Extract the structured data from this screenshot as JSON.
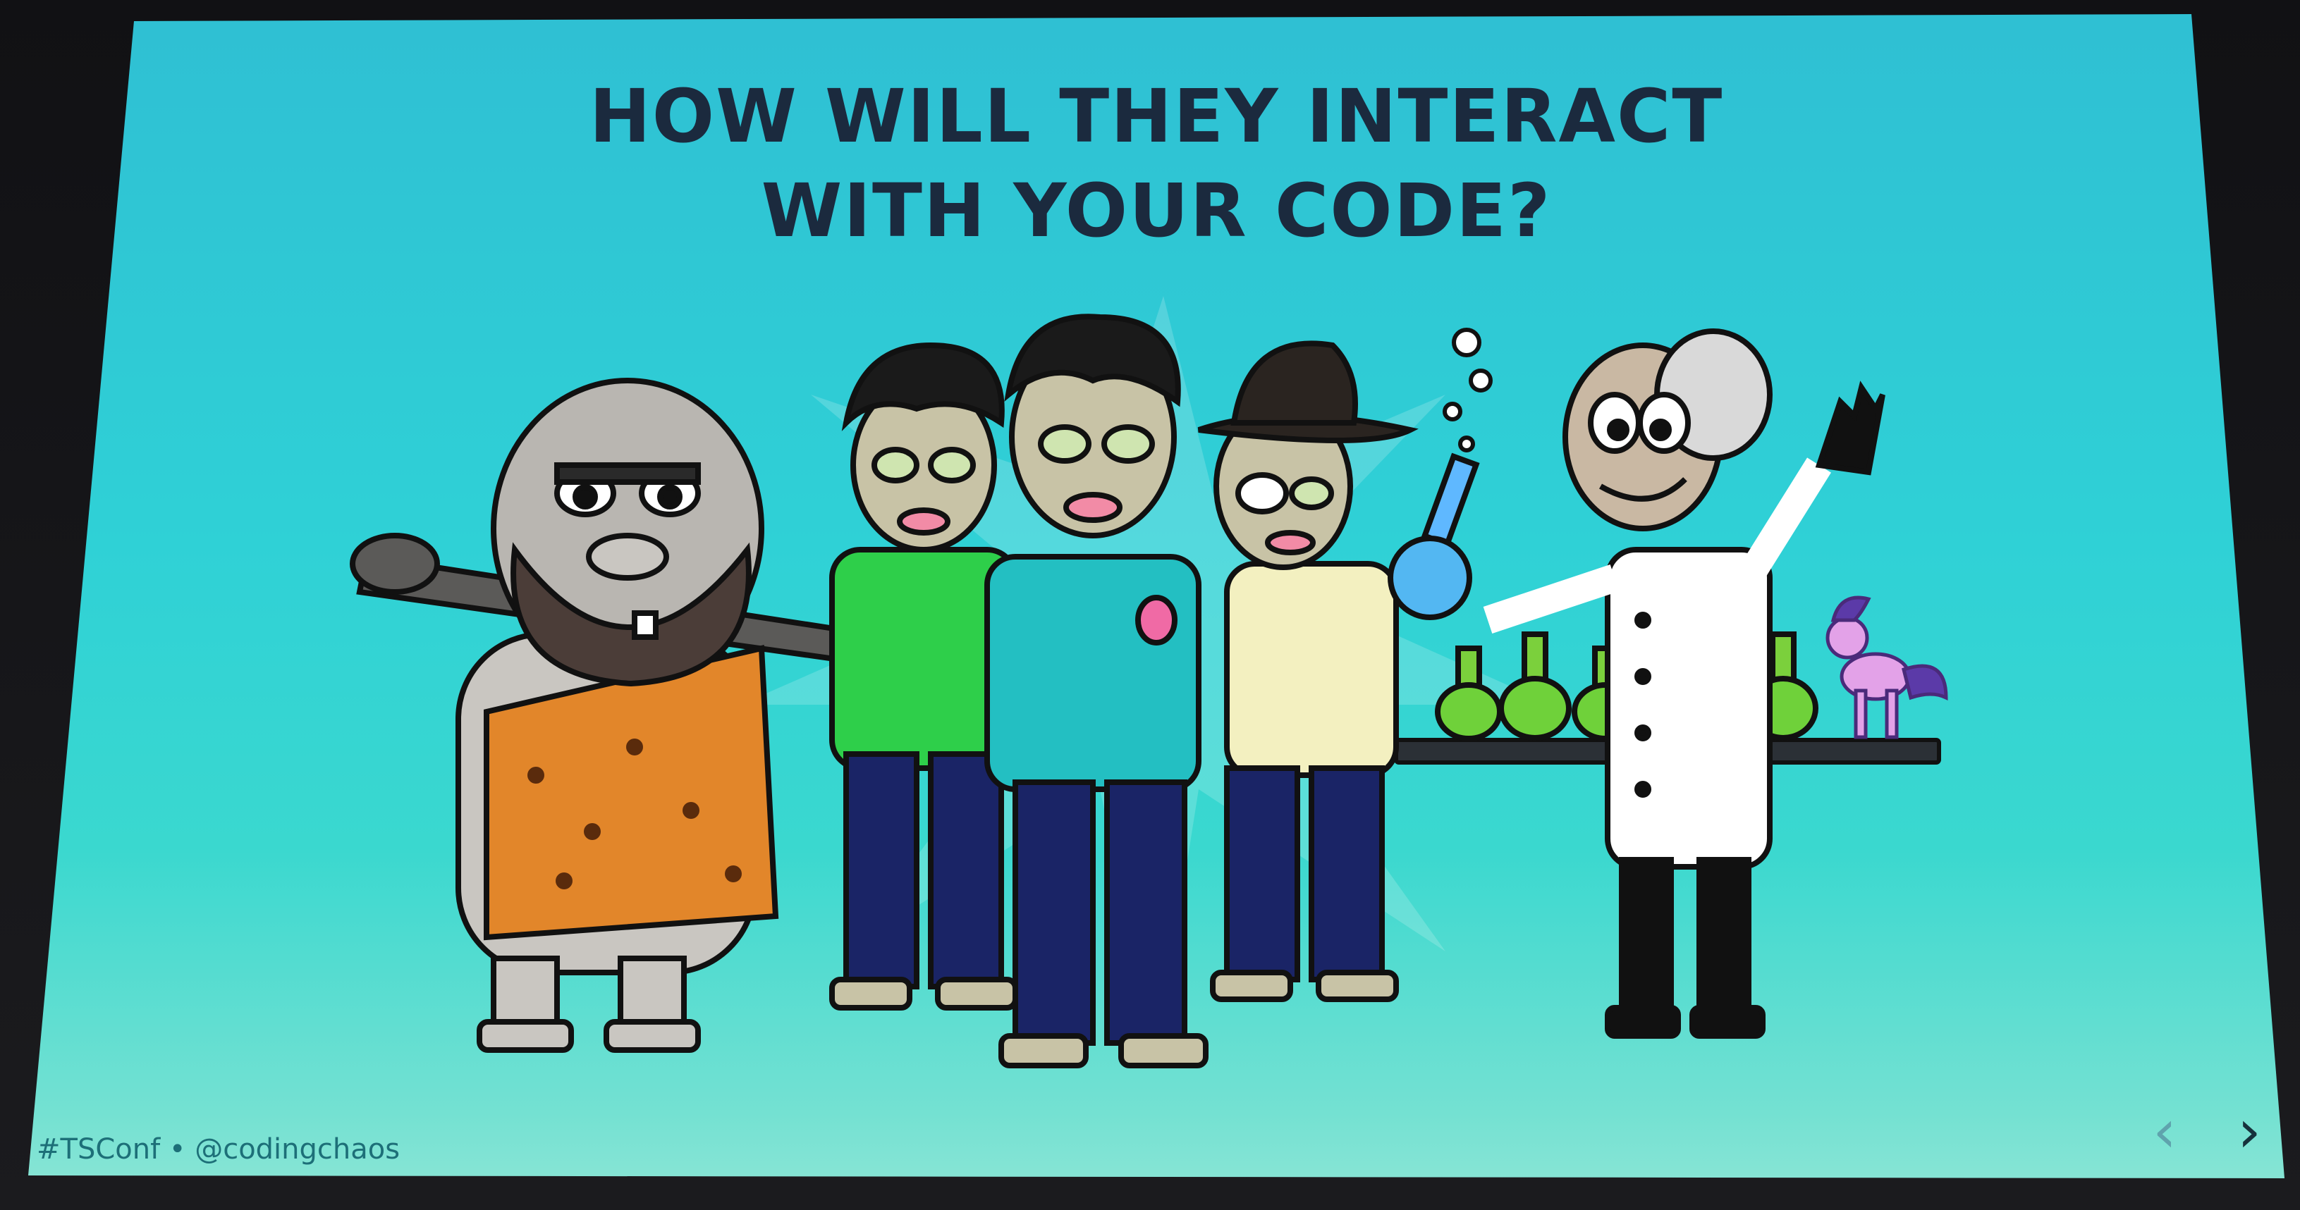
{
  "slide": {
    "title_line1": "HOW WILL THEY INTERACT",
    "title_line2": "WITH YOUR CODE?",
    "footer": "#TSConf • @codingchaos",
    "nav": {
      "prev_icon": "chevron-left-icon",
      "next_icon": "chevron-right-icon",
      "prev_glyph": "‹",
      "next_glyph": "›"
    }
  },
  "colors": {
    "background_top": "#2fbfd3",
    "background_bottom": "#8fe6d6",
    "title": "#1b2a3e",
    "footer": "#1d6f78"
  },
  "illustration": {
    "characters": [
      "caveman",
      "zombie",
      "zombie",
      "zombie",
      "mad-scientist",
      "pony"
    ]
  }
}
